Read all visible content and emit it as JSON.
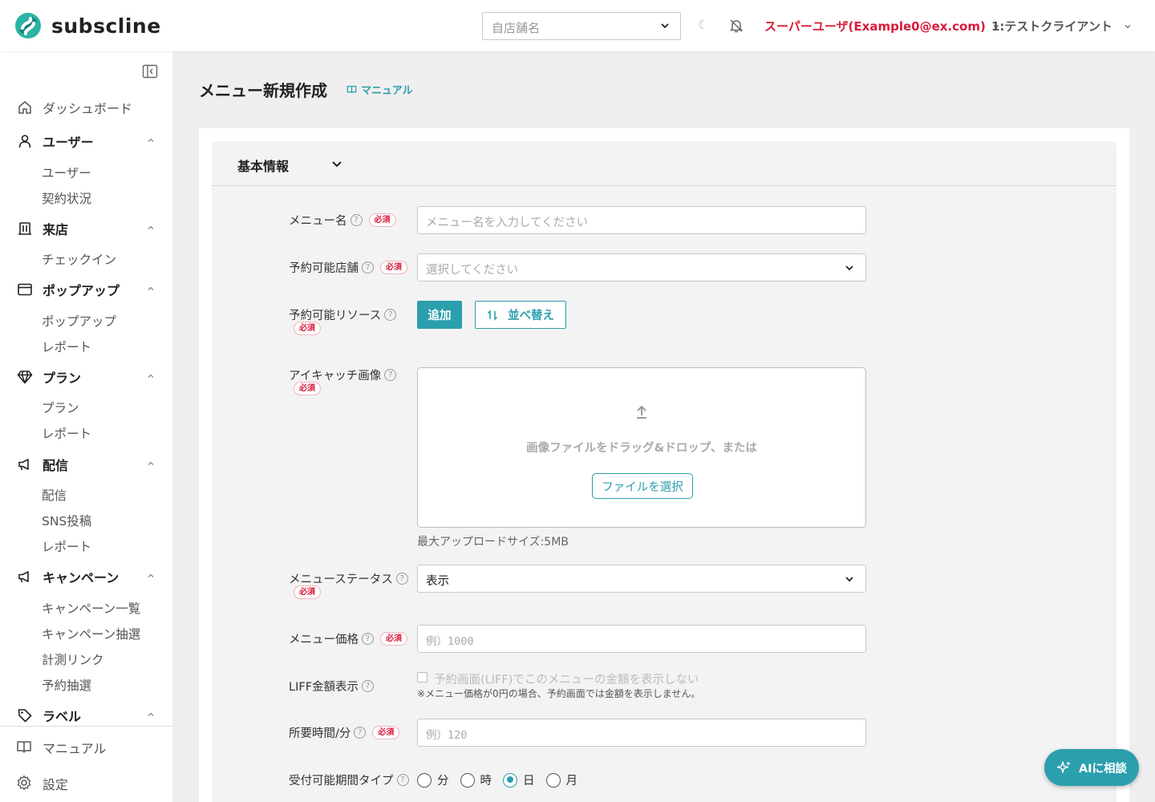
{
  "app": {
    "name": "subscline"
  },
  "header": {
    "store_placeholder": "自店舗名",
    "user_label": "スーパーユーザ(Example0@ex.com)",
    "client_label": "1:テストクライアント"
  },
  "sidebar": {
    "sections": [
      {
        "label": "ダッシュボード",
        "icon": "home-icon"
      },
      {
        "label": "ユーザー",
        "icon": "user-icon",
        "children": [
          "ユーザー",
          "契約状況"
        ]
      },
      {
        "label": "来店",
        "icon": "store-icon",
        "children": [
          "チェックイン"
        ]
      },
      {
        "label": "ポップアップ",
        "icon": "window-icon",
        "children": [
          "ポップアップ",
          "レポート"
        ]
      },
      {
        "label": "プラン",
        "icon": "diamond-icon",
        "children": [
          "プラン",
          "レポート"
        ]
      },
      {
        "label": "配信",
        "icon": "megaphone-icon",
        "children": [
          "配信",
          "SNS投稿",
          "レポート"
        ]
      },
      {
        "label": "キャンペーン",
        "icon": "megaphone-icon",
        "children": [
          "キャンペーン一覧",
          "キャンペーン抽選",
          "計測リンク",
          "予約抽選"
        ]
      },
      {
        "label": "ラベル",
        "icon": "tag-icon"
      }
    ],
    "bottom": [
      {
        "label": "マニュアル",
        "icon": "book-icon"
      },
      {
        "label": "設定",
        "icon": "gear-icon"
      }
    ]
  },
  "page": {
    "title": "メニュー新規作成",
    "manual_link": "マニュアル",
    "section_title": "基本情報"
  },
  "form": {
    "required_badge": "必須",
    "help_mark": "?",
    "menu_name": {
      "label": "メニュー名",
      "placeholder": "メニュー名を入力してください"
    },
    "stores": {
      "label": "予約可能店舗",
      "placeholder": "選択してください"
    },
    "resources": {
      "label": "予約可能リソース",
      "add_button": "追加",
      "sort_button": "並べ替え"
    },
    "eyecatch": {
      "label": "アイキャッチ画像",
      "drop_text": "画像ファイルをドラッグ&ドロップ、または",
      "select_button": "ファイルを選択",
      "max_size": "最大アップロードサイズ:5MB"
    },
    "status": {
      "label": "メニューステータス",
      "value": "表示"
    },
    "price": {
      "label": "メニュー価格",
      "placeholder": "例）1000"
    },
    "liff": {
      "label": "LIFF金額表示",
      "checkbox_label": "予約画面(LIFF)でこのメニューの金額を表示しない",
      "checked": false,
      "note": "※メニュー価格が0円の場合、予約画面では金額を表示しません。"
    },
    "duration": {
      "label": "所要時間/分",
      "placeholder": "例）120"
    },
    "period_type": {
      "label": "受付可能期間タイプ",
      "options": [
        "分",
        "時",
        "日",
        "月"
      ],
      "selected": "日"
    }
  },
  "ai_button": {
    "label": "AIに相談"
  },
  "colors": {
    "accent": "#2b9fad",
    "user_red": "#d81b3a",
    "required_red": "#d81b3a"
  }
}
